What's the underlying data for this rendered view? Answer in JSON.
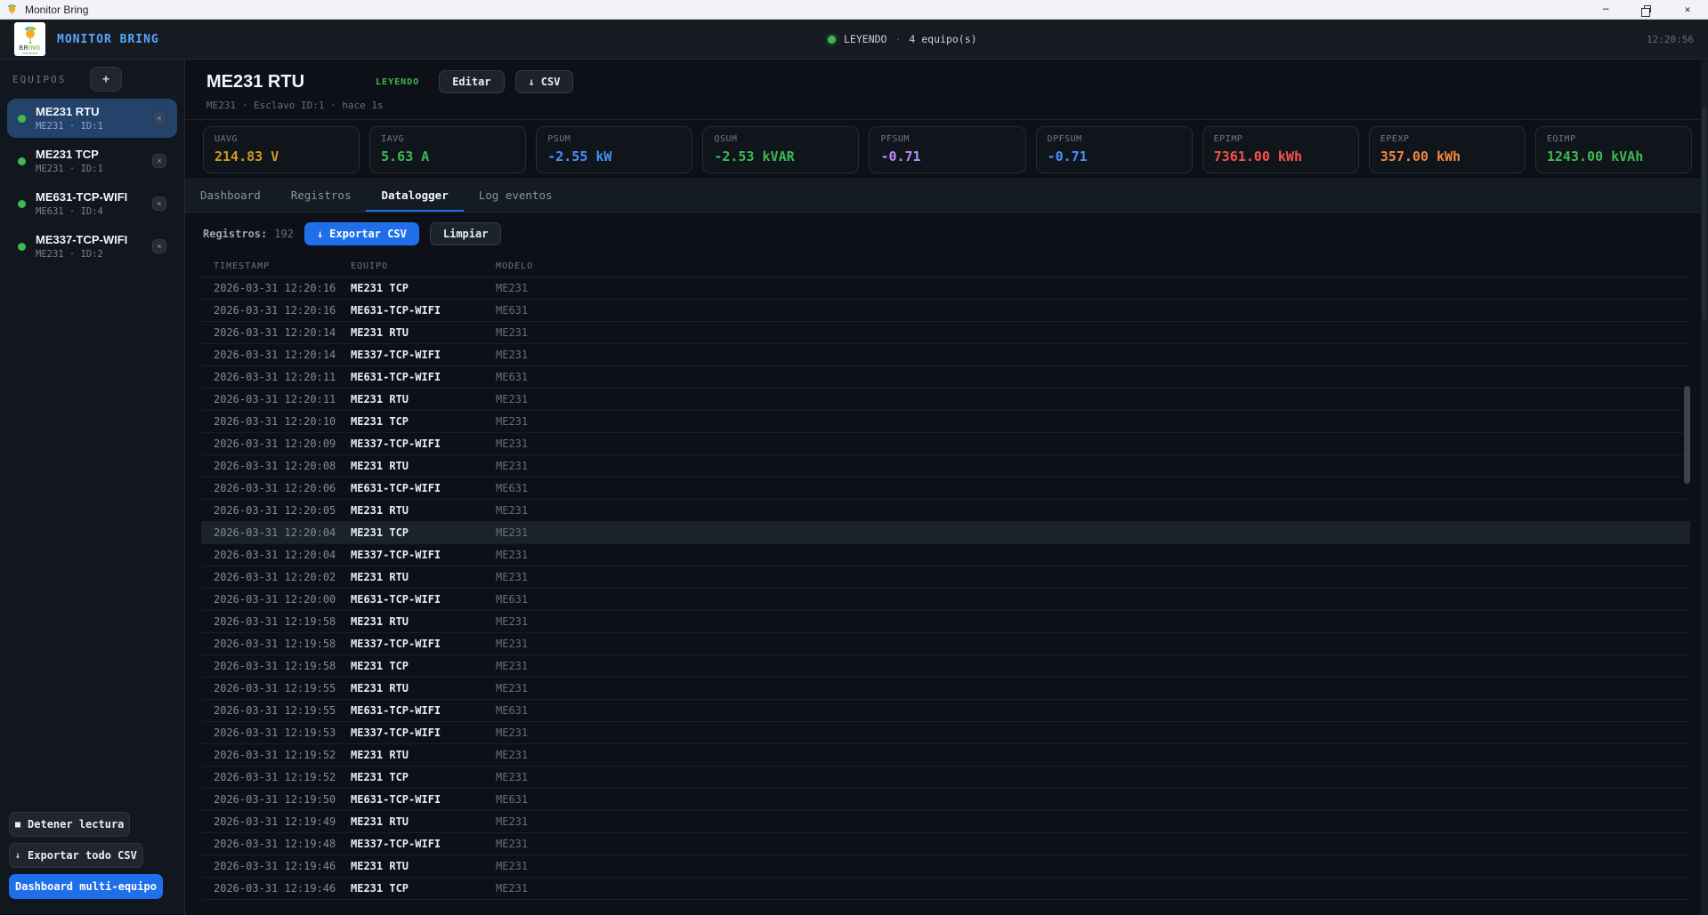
{
  "window": {
    "title": "Monitor Bring",
    "controls": [
      "minimize-icon",
      "restore-icon",
      "close-icon"
    ]
  },
  "app_header": {
    "brand": "MONITOR BRING",
    "logo": {
      "prefix": "BR",
      "suffix": "ING"
    },
    "status": {
      "state_label": "LEYENDO",
      "separator": "·",
      "device_count": "4 equipo(s)"
    },
    "clock": "12:20:56"
  },
  "colors": {
    "accent_blue": "#1f6feb",
    "brand_blue": "#58a6ff",
    "status_green": "#3fb950",
    "selected_item_bg": "#24436b"
  },
  "sidebar": {
    "section_label": "EQUIPOS",
    "add_button_label": "+",
    "items": [
      {
        "name": "ME231 RTU",
        "meta": "ME231 · ID:1",
        "selected": true
      },
      {
        "name": "ME231 TCP",
        "meta": "ME231 · ID:1",
        "selected": false
      },
      {
        "name": "ME631-TCP-WIFI",
        "meta": "ME631 · ID:4",
        "selected": false
      },
      {
        "name": "ME337-TCP-WIFI",
        "meta": "ME231 · ID:2",
        "selected": false
      }
    ],
    "footer_buttons": [
      {
        "name": "stop-reading-button",
        "icon": "stop-square-icon",
        "label": "Detener lectura",
        "style": "dark"
      },
      {
        "name": "export-all-csv-button",
        "icon": "download-arrow-icon",
        "label": "Exportar todo CSV",
        "style": "dark"
      },
      {
        "name": "multi-device-dashboard-button",
        "icon": null,
        "label": "Dashboard multi-equipo",
        "style": "primary"
      }
    ]
  },
  "device_header": {
    "title": "ME231 RTU",
    "status_badge": "LEYENDO",
    "edit_button_label": "Editar",
    "csv_button_label": "CSV",
    "subtitle": "ME231 · Esclavo ID:1 · hace 1s"
  },
  "metric_cards": [
    {
      "label": "UAVG",
      "value": "214.83 V",
      "color": "#d29922"
    },
    {
      "label": "IAVG",
      "value": "5.63 A",
      "color": "#3fb950"
    },
    {
      "label": "PSUM",
      "value": "-2.55 kW",
      "color": "#4493f8"
    },
    {
      "label": "QSUM",
      "value": "-2.53 kVAR",
      "color": "#3fb950"
    },
    {
      "label": "PFSUM",
      "value": "-0.71",
      "color": "#bc8cff"
    },
    {
      "label": "DPFSUM",
      "value": "-0.71",
      "color": "#4493f8"
    },
    {
      "label": "EPIMP",
      "value": "7361.00 kWh",
      "color": "#f85149"
    },
    {
      "label": "EPEXP",
      "value": "357.00 kWh",
      "color": "#f0883e"
    },
    {
      "label": "EQIMP",
      "value": "1243.00 kVAh",
      "color": "#3fb950"
    }
  ],
  "tabs": [
    {
      "label": "Dashboard",
      "active": false
    },
    {
      "label": "Registros",
      "active": false
    },
    {
      "label": "Datalogger",
      "active": true
    },
    {
      "label": "Log eventos",
      "active": false
    }
  ],
  "datalogger": {
    "records_label": "Registros:",
    "records_count": "192",
    "export_button_label": "Exportar CSV",
    "clear_button_label": "Limpiar",
    "table": {
      "columns": [
        "TIMESTAMP",
        "EQUIPO",
        "MODELO"
      ],
      "highlighted_row": 11,
      "rows": [
        [
          "2026-03-31 12:20:16",
          "ME231 TCP",
          "ME231"
        ],
        [
          "2026-03-31 12:20:16",
          "ME631-TCP-WIFI",
          "ME631"
        ],
        [
          "2026-03-31 12:20:14",
          "ME231 RTU",
          "ME231"
        ],
        [
          "2026-03-31 12:20:14",
          "ME337-TCP-WIFI",
          "ME231"
        ],
        [
          "2026-03-31 12:20:11",
          "ME631-TCP-WIFI",
          "ME631"
        ],
        [
          "2026-03-31 12:20:11",
          "ME231 RTU",
          "ME231"
        ],
        [
          "2026-03-31 12:20:10",
          "ME231 TCP",
          "ME231"
        ],
        [
          "2026-03-31 12:20:09",
          "ME337-TCP-WIFI",
          "ME231"
        ],
        [
          "2026-03-31 12:20:08",
          "ME231 RTU",
          "ME231"
        ],
        [
          "2026-03-31 12:20:06",
          "ME631-TCP-WIFI",
          "ME631"
        ],
        [
          "2026-03-31 12:20:05",
          "ME231 RTU",
          "ME231"
        ],
        [
          "2026-03-31 12:20:04",
          "ME231 TCP",
          "ME231"
        ],
        [
          "2026-03-31 12:20:04",
          "ME337-TCP-WIFI",
          "ME231"
        ],
        [
          "2026-03-31 12:20:02",
          "ME231 RTU",
          "ME231"
        ],
        [
          "2026-03-31 12:20:00",
          "ME631-TCP-WIFI",
          "ME631"
        ],
        [
          "2026-03-31 12:19:58",
          "ME231 RTU",
          "ME231"
        ],
        [
          "2026-03-31 12:19:58",
          "ME337-TCP-WIFI",
          "ME231"
        ],
        [
          "2026-03-31 12:19:58",
          "ME231 TCP",
          "ME231"
        ],
        [
          "2026-03-31 12:19:55",
          "ME231 RTU",
          "ME231"
        ],
        [
          "2026-03-31 12:19:55",
          "ME631-TCP-WIFI",
          "ME631"
        ],
        [
          "2026-03-31 12:19:53",
          "ME337-TCP-WIFI",
          "ME231"
        ],
        [
          "2026-03-31 12:19:52",
          "ME231 RTU",
          "ME231"
        ],
        [
          "2026-03-31 12:19:52",
          "ME231 TCP",
          "ME231"
        ],
        [
          "2026-03-31 12:19:50",
          "ME631-TCP-WIFI",
          "ME631"
        ],
        [
          "2026-03-31 12:19:49",
          "ME231 RTU",
          "ME231"
        ],
        [
          "2026-03-31 12:19:48",
          "ME337-TCP-WIFI",
          "ME231"
        ],
        [
          "2026-03-31 12:19:46",
          "ME231 RTU",
          "ME231"
        ],
        [
          "2026-03-31 12:19:46",
          "ME231 TCP",
          "ME231"
        ]
      ]
    }
  }
}
